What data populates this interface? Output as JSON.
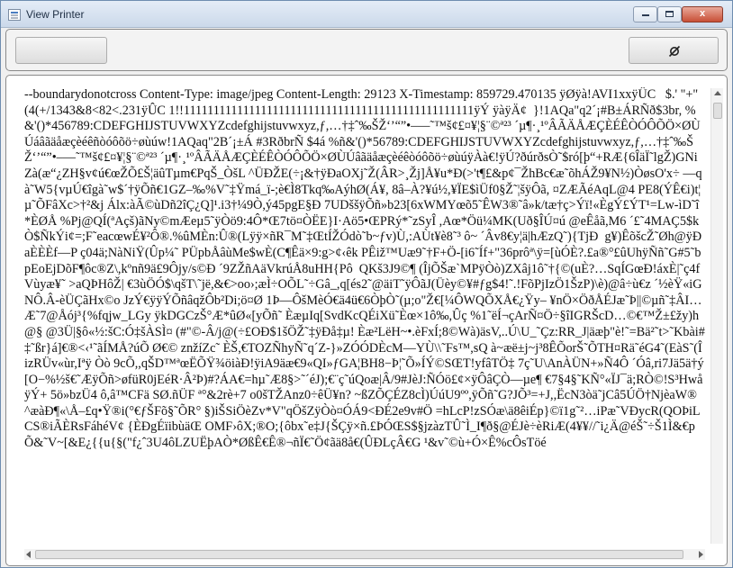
{
  "window": {
    "title": "View Printer",
    "minimize_label": "",
    "maximize_label": "",
    "close_label": "x"
  },
  "toolbar": {
    "left_button_label": "",
    "refresh_icon": "refresh-icon"
  },
  "viewer": {
    "text": "--boundarydonotcross Content-Type: image/jpeg Content-Length: 29123 X-Timestamp: 859729.470135 ÿØÿà!AVI1xxÿÛC   $.' \"+\"(4(+/1343&8<82<.231ÿÛC 1!!1111111111111111111111111111111111111111111111111ÿÝ ÿàÿÄ¢  }!1AQa\"q2´¡#B±ÁRÑð$3br, %&'()*456789:CDEFGHIJSTUVWXYZcdefghijstuvwxyz,ƒ,…†‡ˆ‰ŠŽ‘’“”•–—˜™š¢£¤¥¦§¨©ª²³ ´µ¶·¸¹ºÂÃÄÅÆÇÈÉÊÒÓÔÕÖ×ØÙÚáâãäåæçèéêñòóôõö÷øùúw!1AQaq\"2B´¡±Á #3RðbrÑ $4á %ñ&'()*56789:CDEFGHIJSTUVWXYZcdefghijstuvwxyz,ƒ,…†‡ˆ‰ŠŽ‘’“”•–—˜™š¢£¤¥¦§¨©ª²³ ´µ¶·¸¹ºÂÃÄÅÆÇÈÉÊÒÓÔÕÖ×ØÙÚâãäåæçèéêòóôõö÷øùúÿÀà€!ÿÚ?ðúrðsÒ˜$ró[þ“+RÆ{6ÎäÏ˜lgŽ)GNiZà(æ“¿ZH§v¢ú€œŽÕ£Š¦äûTµm€PqŠ_ÒšL ^ÜÐŽE(÷¡&†ÿÐaOXj˜Ž(ÂR>¸Žj]Å¥u*Ð(>'t¶£&p¢¯ŽhBc€æ˜õhÁŽ9¥N½)ÒøsO'x÷ —qà˜W5{vµÚ€îgà˜w$´†ÿÕñ€1GZ–‰%V˜‡Ÿmá_ï-;è€Ì8Tkq‰AýhØ(Á¥, 8â–À?¥ú½,¥ÏE$ìÜf0§Ž˜¦šÿÔã, ¤ZÆÃéAqL@4 PE8(ÝÊ€i)t¦µ˜ÕFâXc>†²&j Álx:àÃ©ùDñ2îÇ¿Q]¹.i3†¼9Ò,ý45pgE§Ð 7UDššÿÕñ»b23[6xWMYœõ5˜ÊW3®˜â»k/tæ†ç>Ýï!«ÈgÝ£ÝT¹=Lw-ìD˜î*ÈØÅ %Pj@QÍ(ªAçš)ãNy©mÆeµ5˜ÿÒö9:4Ô*Œ7tö¤ÒËE}I·Aö5•ŒPRý*˜zSyÎ ,Aœ*Öü¼MK(Uð§ÎÚ¤ú @eÊåã,M6 ´£˜4MAÇ5$kÒ$ÑkÝi¢=;F˜eacœwÉ¥²Ô®.%ûMÈn:Û®(Lÿÿ×ñR¯M˜‡ŒtÍŽÓdò˜b~ƒv)Ù,:AÙt¥è8˜³ ô~ ´Âv8€y¦ä|hÆzQ˜){TjÐ  g¥)ÊõšcŽ˜Øh@ÿÐaÈÈÈf—P ç04ä;NàNiŸ(Ûp¼˜ PÜpbÅâùMe$wÈ(C¶Êä×9:g>¢‹êk PÊiž™Uæ9˜†F+Ö-[i6˜Íf+\"36prôª\\ÿ=[ùÓÈ?.£a®°£ûUhÿÑñ˜G#5˜bpEoEjDõF¶ôc®Z\\,kºnñ9ä£9Ôjy/s©Ð ´9ZŽñAäVkrúÅ8uHH{Pô  QKš3J9©¶ (ÎjÕŠæ`MPÿÒò)ZXâj1ô˜†{©(uÈ?…SqÍGœÐ!áxÈ|˜ç4fVùyæ¥˜ >aQÞHôŽ| €3ùÖÓ$\\qšT\\˜jë,&€>oo›;æÌ÷OÕL˜÷Gâ_,q[és2˜@äiT˜ÿÔãJ(Üèy©¥#ƒg$4!˜.!FõPjIzÖ1ŠzP)\\è)@â÷ù€z ´½èŸ«iGNÔ.Â-èÜÇãHx©o JzÝ€ÿÿÝÕñâqžÔb²Di;ö¤Ø 1Þ—ÔšMèÓ€ä4ü€6ÒþÒ˜(µ;o\"Ž€[¼ÔWQÕXÅ€¿Ÿy– ¥nÖ×ÖðÅÉJæ˜Þ||©µñ˜‡ÂI…Æ˜7@Åój³{%fqjw_LGy ÿkDGCzŠ°Æ*ûØ«[yÕñ˜ ÈæµIq[SvdKcQÉiXü˜Èœ×1ô‰,Ûç %1˜ëÍ¬çArÑ¤Ö÷§îIGRŠcD…©€™Ž±£žy)h@§ @3Ü|§ô«½:šC:Ó‡šÀSÌ¤ (#\"©-Â/j@(÷£OÐ$1šÖŽ˜‡ÿÐå‡µ! Èæ²LëH~•.èFxÍ;8©Wà)äsV,..Ú\\U_˜Çz:RR_J|äæþ\"è!˜=Bä²˜t>˜Kbài#‡˜ßr}á]€®<‹¹˜ãÍMÅ?úÕ Ø€© znžíZc˜ ÈŠ,€TOZÑhyÑ˜q´Z-}»ZÓÓDÈcM—YÙ\\\\˜Fs™,sQ à~æë±j~j³8ÊÕorŠ˜ÕTH¤Rä˜éG4˜(EàS˜(ÎizRÜv«ùr,Iªÿ Òò 9cÕ,,qŠD™ªœËÕŸ¾öiàÐ!ÿiA9äæ€9«QI»ƒGA¦BH8−Þ¦˜Õ»ÍÝ©SŒT!yfâTÖ‡ 7ç˜U\\AnÀÜN+»Ñ4Ô ´Óâ,ri7Jä5ä†ý[O−%½š€˜ÆÿÕñ>øfüR0jEéR·Â²Þ)#?ÁA€=hµ˜Æ8§>˜´éJ);€¨ç˜úQoæ|Â/9#JèJ:ÑÓö£¢×ÿÔâÇÒ—µe¶ €7§4§˜KÑ°«ÏJ¯ä;RÒ©!S³HwåÿÝ+ 5ö»bzÜ4 ô,â™CFä SØ.ñÜF ª°&2rè+7 o0šTŽAnz0÷êÜ¥n? ~ßZÕÇÉZ8cÌ)ÚúU9ºº,ÿÕñ˜G?JÕ³=+J,,ËcN3òä˜jCâ5ÚÖ†NjèaW® ^æàÐ¶«\\Å–£q•Ÿ®i(°€ƒŠFõ§˜ÕR° §)iŠSiÖèZv*V\"qÖšZÿÒò¤ÓÁ9<ÐÉ2e9v#Ö =hLcP!zSÓæ\\ä8êiÉp}©ï1g˜²…iPæ˜VÐycR(QOÞiLCS®iÃÈRsFáhéV¢ {ÈÐgÉïibùäŒ OMF›ôX;®O;{ôbx˜e‡J{ŠÇÿ×ñ.£ÞÓŒS$§jzàzTÛ˜Ì_I¶ð§@ÉJè÷èRiÆ(4¥¥//˜i¿Ä@éŠ˜÷Š1Ì&€p Õ&˜V~[&E¿{{u{§(\"f¿ˆ3U4ôLZUËþAÒ*ØßÊ€Ê®¬ñÏ€˜Ö¢ãä8å€(ÛÐLçÂ€G ¹&v˜©ù+Ó×Ê%cÔsTöé"
  }
}
